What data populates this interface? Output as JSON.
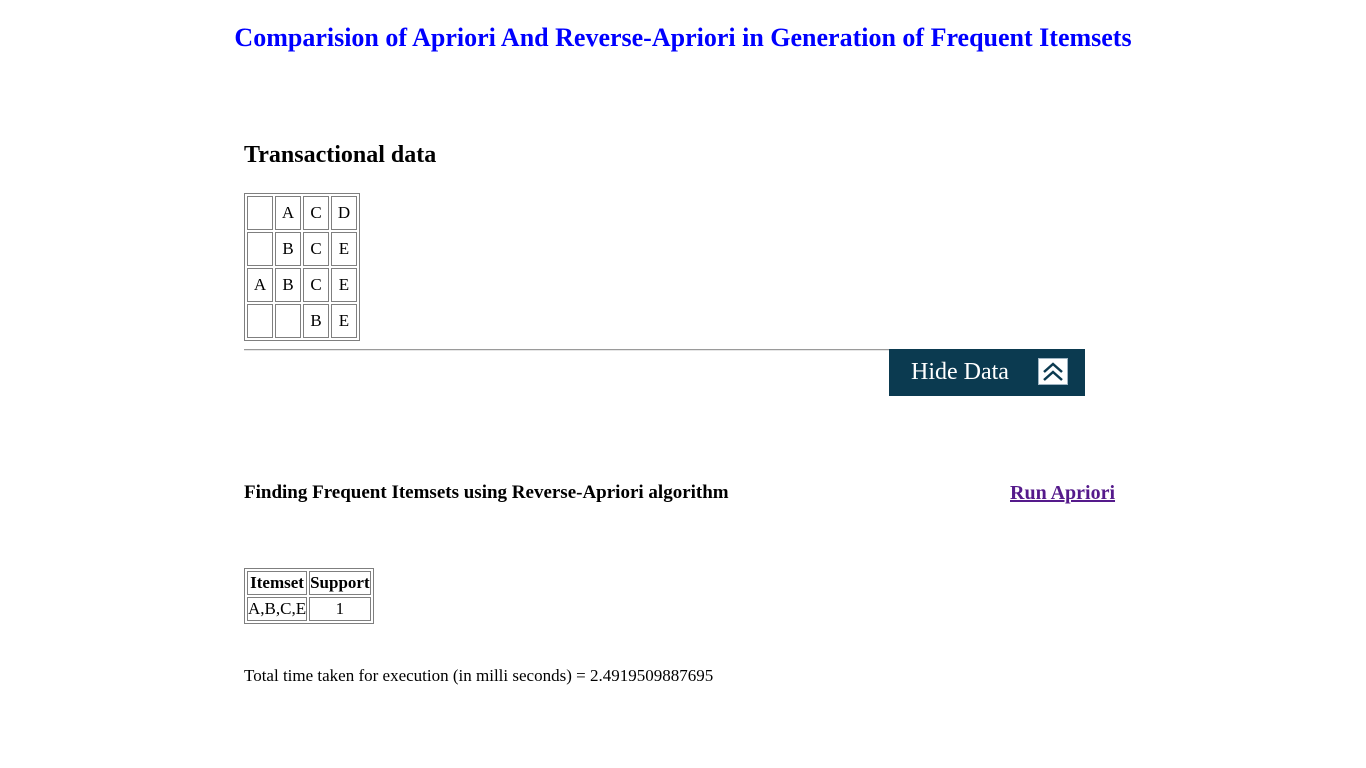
{
  "title": "Comparision of Apriori And Reverse-Apriori in Generation of Frequent Itemsets",
  "transactional_data": {
    "heading": "Transactional data",
    "rows": [
      [
        "",
        "A",
        "C",
        "D"
      ],
      [
        "",
        "B",
        "C",
        "E"
      ],
      [
        "A",
        "B",
        "C",
        "E"
      ],
      [
        "",
        "",
        "B",
        "E"
      ]
    ]
  },
  "hide_button": {
    "label": "Hide Data",
    "icon": "double-chevron-up-icon",
    "background": "#0b3a50"
  },
  "algorithm": {
    "heading": "Finding Frequent Itemsets using Reverse-Apriori algorithm",
    "run_link": "Run Apriori"
  },
  "results": {
    "headers": [
      "Itemset",
      "Support"
    ],
    "rows": [
      [
        "A,B,C,E",
        "1"
      ]
    ]
  },
  "timing": {
    "text": "Total time taken for execution (in milli seconds) = 2.4919509887695"
  },
  "colors": {
    "title": "#0000ff",
    "link_visited": "#551a8b"
  }
}
